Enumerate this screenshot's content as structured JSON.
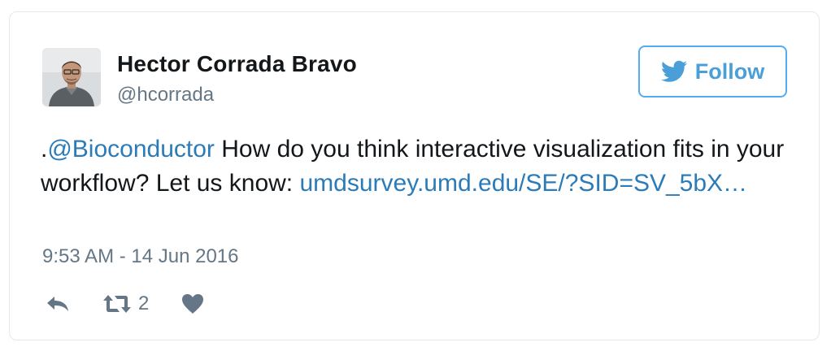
{
  "author": {
    "name": "Hector Corrada Bravo",
    "handle": "@hcorrada"
  },
  "follow_button": {
    "label": "Follow",
    "icon": "twitter-bird-icon"
  },
  "tweet": {
    "prefix": ".",
    "mention": "@Bioconductor",
    "text_1": " How do you think interactive visualization fits in your workflow? Let us know: ",
    "link": "umdsurvey.umd.edu/SE/?SID=SV_5bX…",
    "timestamp": "9:53 AM - 14 Jun 2016"
  },
  "actions": {
    "reply_icon": "reply-icon",
    "retweet_icon": "retweet-icon",
    "retweet_count": "2",
    "like_icon": "heart-icon"
  },
  "colors": {
    "accent": "#55acee",
    "link": "#2b7bb9",
    "text": "#14171a",
    "muted": "#657786",
    "border": "#e1e8ed"
  }
}
